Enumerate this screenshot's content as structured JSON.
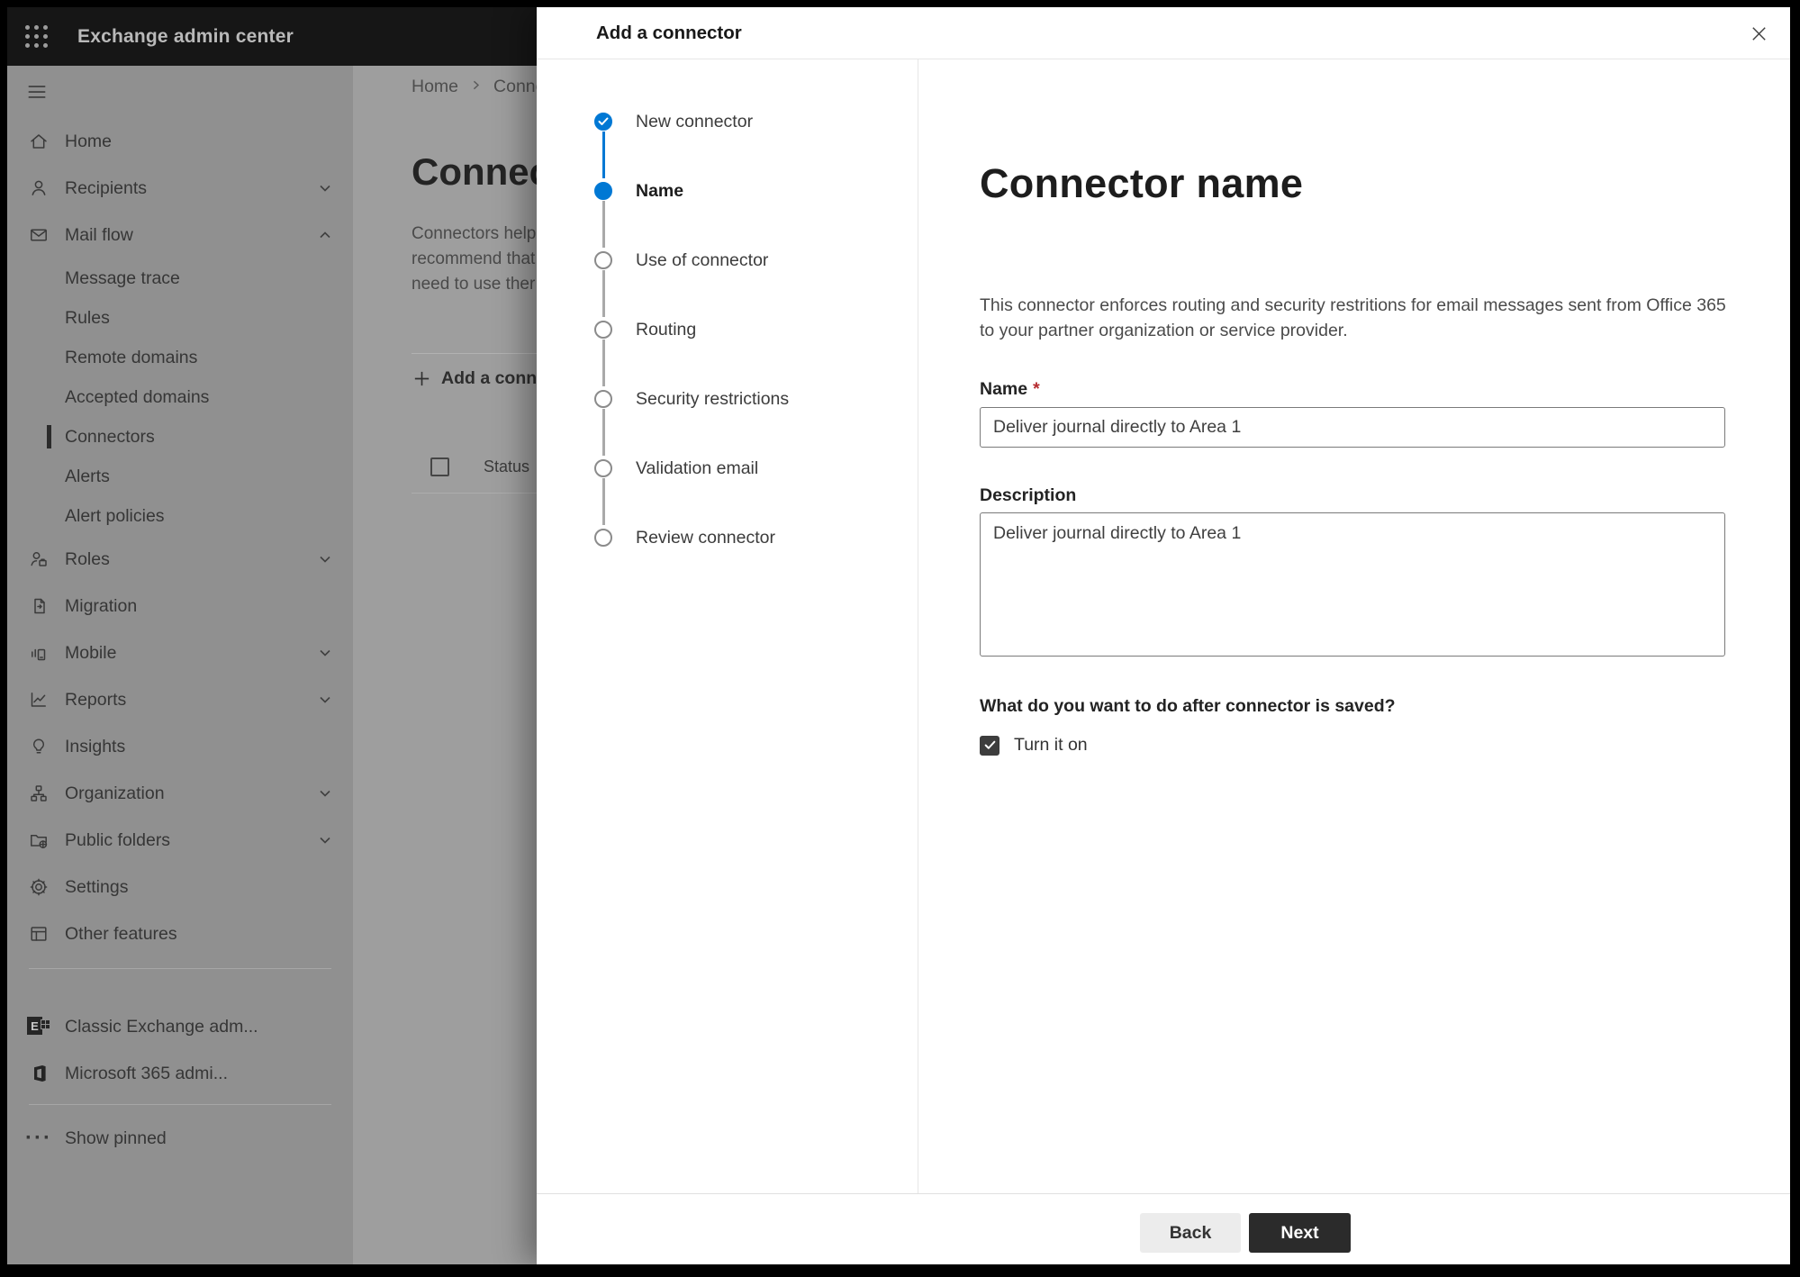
{
  "topbar": {
    "title": "Exchange admin center"
  },
  "sidebar": {
    "items": [
      {
        "label": "Home",
        "icon": "home"
      },
      {
        "label": "Recipients",
        "icon": "person",
        "chevron": "down"
      },
      {
        "label": "Mail flow",
        "icon": "mail",
        "chevron": "up",
        "expanded": true
      },
      {
        "label": "Message trace",
        "sub": true
      },
      {
        "label": "Rules",
        "sub": true
      },
      {
        "label": "Remote domains",
        "sub": true
      },
      {
        "label": "Accepted domains",
        "sub": true
      },
      {
        "label": "Connectors",
        "sub": true,
        "selected": true
      },
      {
        "label": "Alerts",
        "sub": true
      },
      {
        "label": "Alert policies",
        "sub": true
      },
      {
        "label": "Roles",
        "icon": "roles",
        "chevron": "down"
      },
      {
        "label": "Migration",
        "icon": "migration"
      },
      {
        "label": "Mobile",
        "icon": "mobile",
        "chevron": "down"
      },
      {
        "label": "Reports",
        "icon": "reports",
        "chevron": "down"
      },
      {
        "label": "Insights",
        "icon": "lightbulb"
      },
      {
        "label": "Organization",
        "icon": "org-chart",
        "chevron": "down"
      },
      {
        "label": "Public folders",
        "icon": "folder-globe",
        "chevron": "down"
      },
      {
        "label": "Settings",
        "icon": "gear"
      },
      {
        "label": "Other features",
        "icon": "table"
      },
      {
        "label": "Classic Exchange adm...",
        "icon": "exchange-logo"
      },
      {
        "label": "Microsoft 365 admi...",
        "icon": "m365-logo"
      },
      {
        "label": "Show pinned",
        "icon": "ellipsis"
      }
    ]
  },
  "page": {
    "breadcrumb": {
      "home": "Home",
      "current": "Conne"
    },
    "title": "Connec",
    "paragraph_lines": [
      "Connectors help",
      "recommend that",
      "need to use ther"
    ],
    "add_button": "Add a conn",
    "table_header": "Status"
  },
  "modal": {
    "title": "Add a connector",
    "steps": [
      {
        "label": "New connector",
        "state": "completed"
      },
      {
        "label": "Name",
        "state": "current"
      },
      {
        "label": "Use of connector",
        "state": "upcoming"
      },
      {
        "label": "Routing",
        "state": "upcoming"
      },
      {
        "label": "Security restrictions",
        "state": "upcoming"
      },
      {
        "label": "Validation email",
        "state": "upcoming"
      },
      {
        "label": "Review connector",
        "state": "upcoming"
      }
    ],
    "content": {
      "heading": "Connector name",
      "description": "This connector enforces routing and security restritions for email messages sent from Office 365 to your partner organization or service provider.",
      "name_label": "Name",
      "required_mark": "*",
      "name_value": "Deliver journal directly to Area 1",
      "description_label": "Description",
      "description_value": "Deliver journal directly to Area 1",
      "question": "What do you want to do after connector is saved?",
      "checkbox_label": "Turn it on",
      "checkbox_checked": true
    },
    "footer": {
      "back": "Back",
      "next": "Next"
    }
  },
  "colors": {
    "accent": "#0078d4",
    "next_button_bg": "#2b2b2b",
    "required_mark": "#b52b2f",
    "topbar_bg": "#161616"
  }
}
